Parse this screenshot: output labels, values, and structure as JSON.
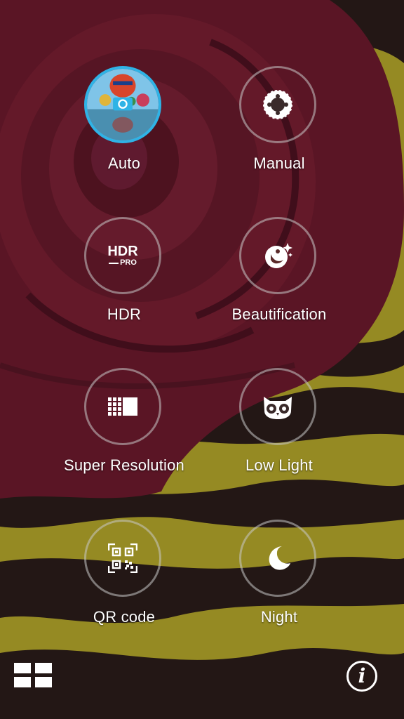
{
  "modes": [
    {
      "label": "Auto",
      "icon": "auto-hot-air-balloon-icon",
      "active": true
    },
    {
      "label": "Manual",
      "icon": "aperture-dial-icon",
      "active": false
    },
    {
      "label": "HDR",
      "icon": "hdr-pro-icon",
      "badge_main": "HDR",
      "badge_sub": "PRO",
      "active": false
    },
    {
      "label": "Beautification",
      "icon": "beauty-face-sparkle-icon",
      "active": false
    },
    {
      "label": "Super Resolution",
      "icon": "super-resolution-grid-icon",
      "active": false
    },
    {
      "label": "Low Light",
      "icon": "owl-icon",
      "active": false
    },
    {
      "label": "QR code",
      "icon": "qr-code-icon",
      "active": false
    },
    {
      "label": "Night",
      "icon": "moon-icon",
      "active": false
    }
  ],
  "bottom_bar": {
    "grid_icon": "grid-view-icon",
    "info_icon": "info-icon",
    "info_glyph": "i"
  },
  "colors": {
    "active_ring": "#2fb3e6",
    "ring": "#c8c8c8",
    "text": "#ffffff"
  }
}
